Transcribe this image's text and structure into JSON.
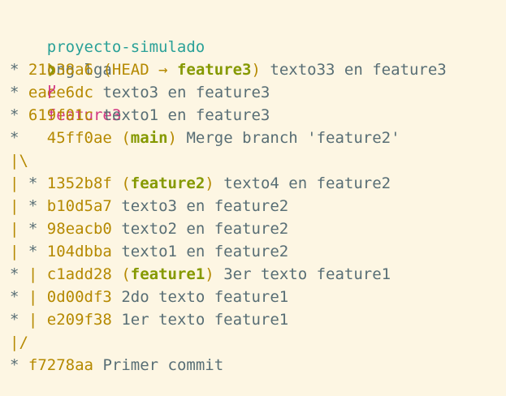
{
  "prompt": {
    "directory": "proyecto-simulado",
    "on_word": "on",
    "branch_icon": "git-branch-icon",
    "branch": "feature3",
    "symbol": "❯",
    "command": "g lga"
  },
  "log": [
    {
      "graph_star": "*",
      "graph_rest": " ",
      "hash": "21b38a6",
      "refs_open": "(HEAD → ",
      "ref": "feature3",
      "refs_close": ")",
      "message": "texto33 en feature3"
    },
    {
      "graph_star": "*",
      "graph_rest": " ",
      "hash": "eaee6dc",
      "refs_open": "",
      "ref": "",
      "refs_close": "",
      "message": "texto3 en feature3"
    },
    {
      "graph_star": "*",
      "graph_rest": " ",
      "hash": "619f01c",
      "refs_open": "",
      "ref": "",
      "refs_close": "",
      "message": "texto1 en feature3"
    },
    {
      "graph_star": "*",
      "graph_rest": "   ",
      "hash": "45ff0ae",
      "refs_open": "(",
      "ref": "main",
      "refs_close": ")",
      "message": "Merge branch 'feature2'"
    },
    {
      "graph_only": "|\\"
    },
    {
      "graph_pre": "| ",
      "graph_star": "*",
      "graph_rest": " ",
      "hash": "1352b8f",
      "refs_open": "(",
      "ref": "feature2",
      "refs_close": ")",
      "message": "texto4 en feature2"
    },
    {
      "graph_pre": "| ",
      "graph_star": "*",
      "graph_rest": " ",
      "hash": "b10d5a7",
      "refs_open": "",
      "ref": "",
      "refs_close": "",
      "message": "texto3 en feature2"
    },
    {
      "graph_pre": "| ",
      "graph_star": "*",
      "graph_rest": " ",
      "hash": "98eacb0",
      "refs_open": "",
      "ref": "",
      "refs_close": "",
      "message": "texto2 en feature2"
    },
    {
      "graph_pre": "| ",
      "graph_star": "*",
      "graph_rest": " ",
      "hash": "104dbba",
      "refs_open": "",
      "ref": "",
      "refs_close": "",
      "message": "texto1 en feature2"
    },
    {
      "graph_star": "*",
      "graph_rest": " | ",
      "hash": "c1add28",
      "refs_open": "(",
      "ref": "feature1",
      "refs_close": ")",
      "message": "3er texto feature1"
    },
    {
      "graph_star": "*",
      "graph_rest": " | ",
      "hash": "0d00df3",
      "refs_open": "",
      "ref": "",
      "refs_close": "",
      "message": "2do texto feature1"
    },
    {
      "graph_star": "*",
      "graph_rest": " | ",
      "hash": "e209f38",
      "refs_open": "",
      "ref": "",
      "refs_close": "",
      "message": "1er texto feature1"
    },
    {
      "graph_only": "|/"
    },
    {
      "graph_star": "*",
      "graph_rest": " ",
      "hash": "f7278aa",
      "refs_open": "",
      "ref": "",
      "refs_close": "",
      "message": "Primer commit"
    }
  ]
}
